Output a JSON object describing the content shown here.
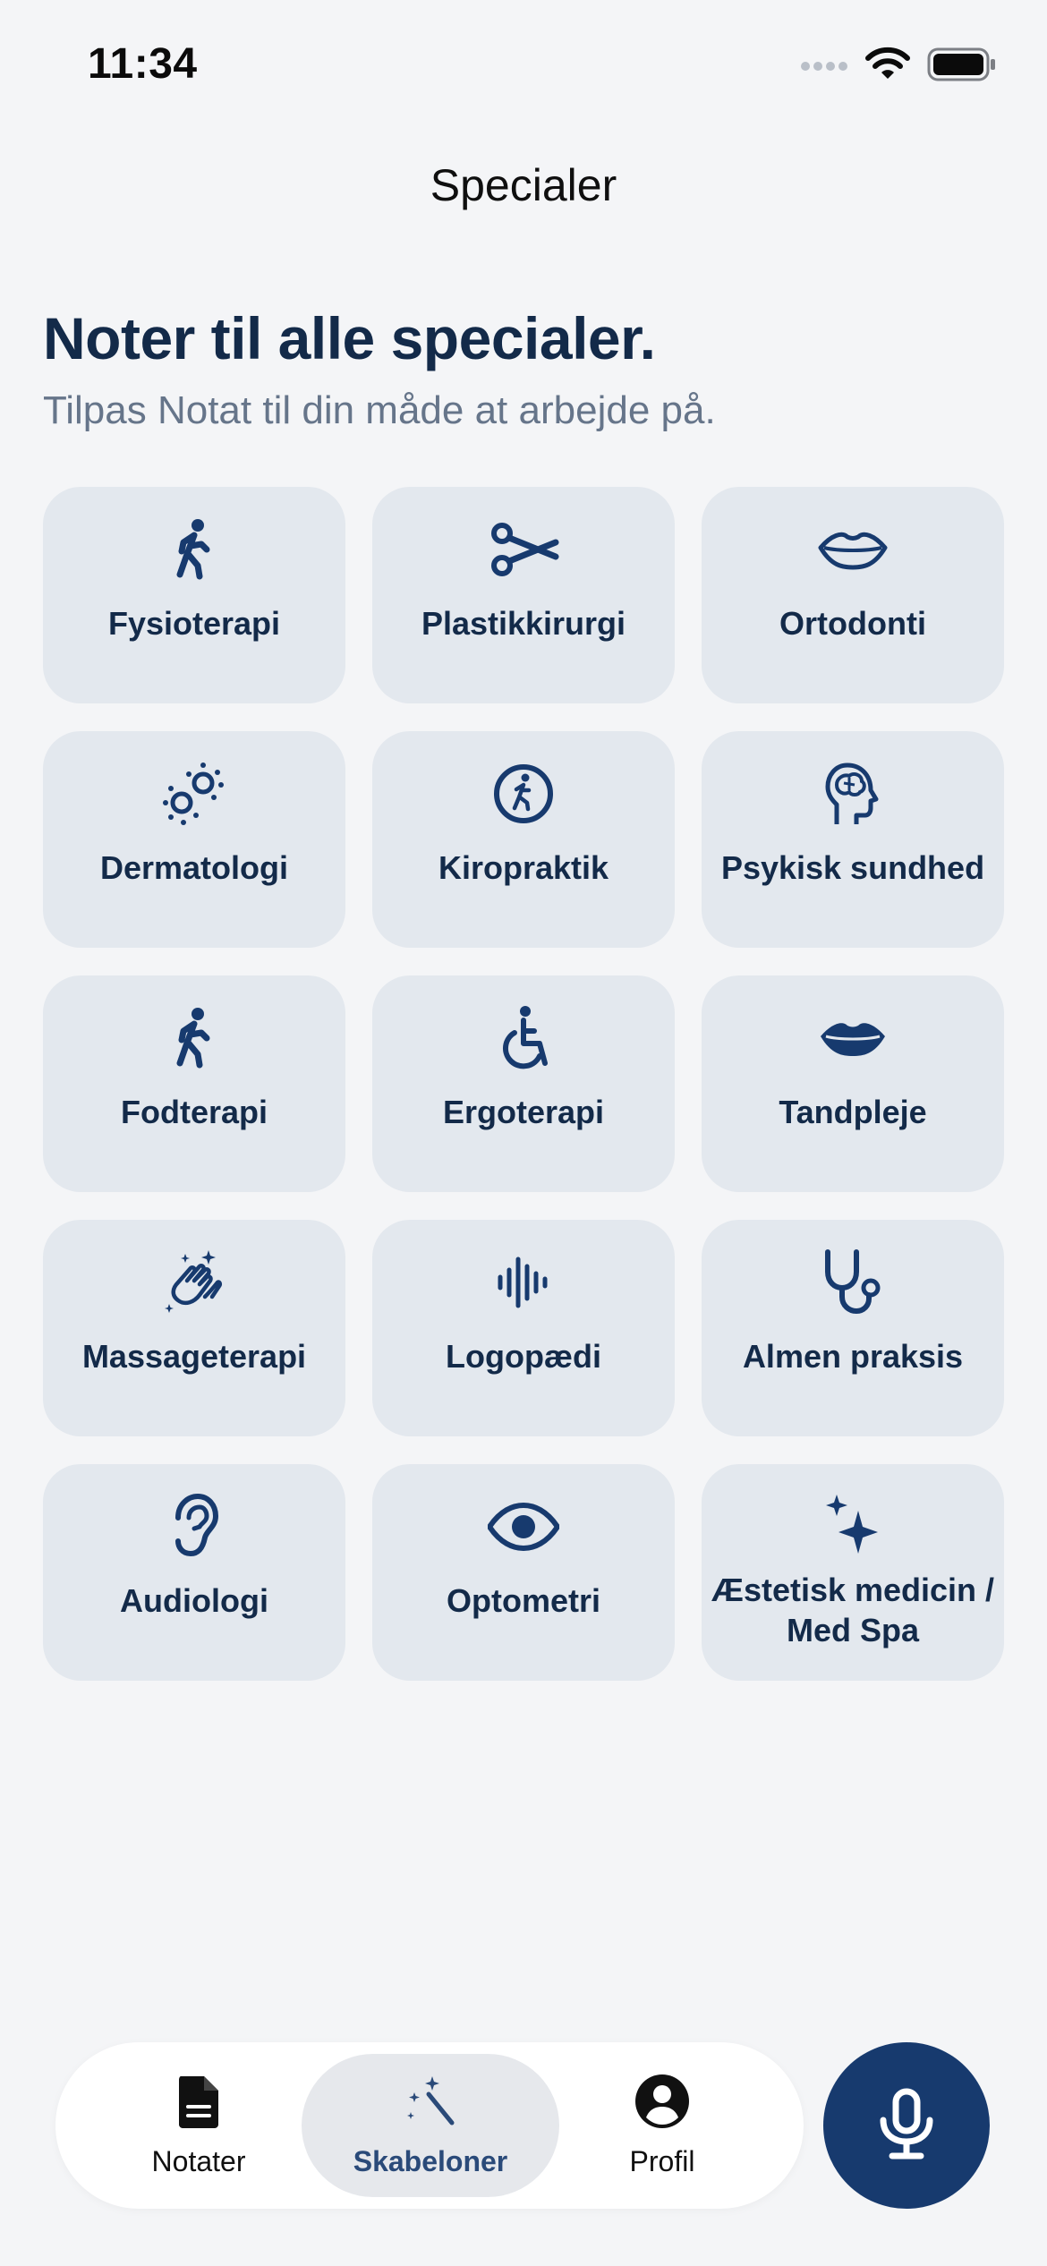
{
  "status_bar": {
    "time": "11:34"
  },
  "nav": {
    "title": "Specialer"
  },
  "hero": {
    "headline": "Noter til alle specialer.",
    "subline": "Tilpas Notat til din måde at arbejde på."
  },
  "specialties": [
    {
      "label": "Fysioterapi",
      "icon": "walking-person-icon"
    },
    {
      "label": "Plastikkirurgi",
      "icon": "scissors-icon"
    },
    {
      "label": "Ortodonti",
      "icon": "lips-outline-icon"
    },
    {
      "label": "Dermatologi",
      "icon": "allergens-icon"
    },
    {
      "label": "Kiropraktik",
      "icon": "walking-circle-icon"
    },
    {
      "label": "Psykisk sundhed",
      "icon": "head-brain-icon"
    },
    {
      "label": "Fodterapi",
      "icon": "walking-person-icon"
    },
    {
      "label": "Ergoterapi",
      "icon": "wheelchair-icon"
    },
    {
      "label": "Tandpleje",
      "icon": "lips-filled-icon"
    },
    {
      "label": "Massageterapi",
      "icon": "hands-clap-icon"
    },
    {
      "label": "Logopædi",
      "icon": "waveform-icon"
    },
    {
      "label": "Almen praksis",
      "icon": "stethoscope-icon"
    },
    {
      "label": "Audiologi",
      "icon": "ear-icon"
    },
    {
      "label": "Optometri",
      "icon": "eye-icon"
    },
    {
      "label": "Æstetisk medicin / Med Spa",
      "icon": "sparkles-icon"
    }
  ],
  "tabbar": {
    "notes_label": "Notater",
    "templates_label": "Skabeloner",
    "profile_label": "Profil",
    "active_tab": "Skabeloner"
  },
  "colors": {
    "background": "#f4f5f7",
    "card": "#e3e8ee",
    "primary": "#132a49",
    "accent": "#173a6e",
    "muted": "#66758a"
  }
}
